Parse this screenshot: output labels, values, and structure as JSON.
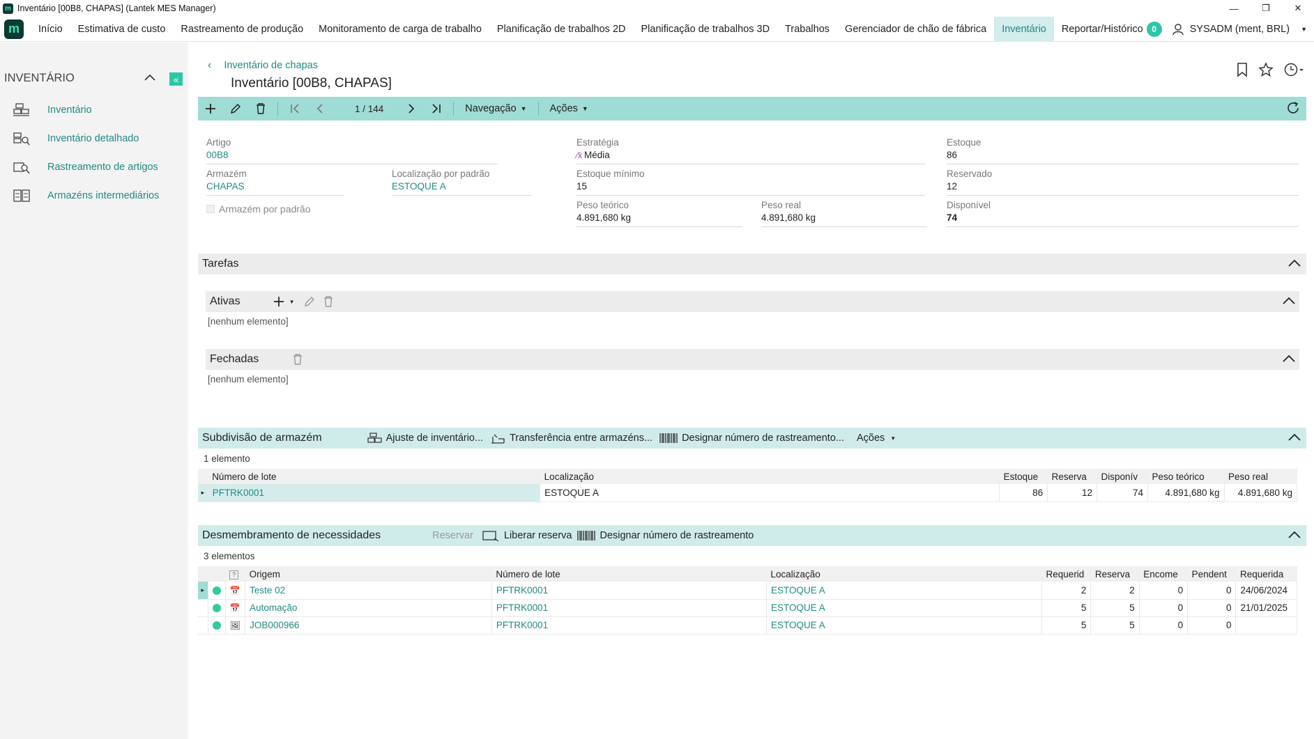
{
  "window": {
    "title": "Inventário [00B8, CHAPAS] (Lantek MES Manager)"
  },
  "menu": {
    "items": [
      "Início",
      "Estimativa de custo",
      "Rastreamento de produção",
      "Monitoramento de carga de trabalho",
      "Planificação de trabalhos 2D",
      "Planificação de trabalhos 3D",
      "Trabalhos",
      "Gerenciador de chão de fábrica",
      "Inventário",
      "Reportar/Histórico"
    ],
    "notifications": "0",
    "user": "SYSADM (ment, BRL)"
  },
  "sidebar": {
    "heading": "INVENTÁRIO",
    "items": [
      {
        "label": "Inventário",
        "icon": "inventory-icon"
      },
      {
        "label": "Inventário detalhado",
        "icon": "detailed-inventory-icon"
      },
      {
        "label": "Rastreamento de artigos",
        "icon": "item-tracking-icon"
      },
      {
        "label": "Armazéns intermediários",
        "icon": "intermediate-warehouse-icon"
      }
    ]
  },
  "header": {
    "breadcrumb": "Inventário de chapas",
    "title": "Inventário [00B8, CHAPAS]"
  },
  "toolbar": {
    "pager": "1 / 144",
    "navigation": "Navegação",
    "actions": "Ações"
  },
  "form": {
    "artigo": {
      "label": "Artigo",
      "value": "00B8"
    },
    "armazem": {
      "label": "Armazém",
      "value": "CHAPAS"
    },
    "localizacao": {
      "label": "Localização por padrão",
      "value": "ESTOQUE A"
    },
    "armazem_padrao": {
      "label": "Armazém por padrão"
    },
    "estrategia": {
      "label": "Estratégia",
      "value": "Média"
    },
    "estoque_minimo": {
      "label": "Estoque mínimo",
      "value": "15"
    },
    "peso_teorico": {
      "label": "Peso teórico",
      "value": "4.891,680 kg"
    },
    "peso_real": {
      "label": "Peso real",
      "value": "4.891,680 kg"
    },
    "estoque": {
      "label": "Estoque",
      "value": "86"
    },
    "reservado": {
      "label": "Reservado",
      "value": "12"
    },
    "disponivel": {
      "label": "Disponível",
      "value": "74"
    }
  },
  "tarefas": {
    "title": "Tarefas",
    "ativas": {
      "title": "Ativas",
      "empty": "[nenhum elemento]"
    },
    "fechadas": {
      "title": "Fechadas",
      "empty": "[nenhum elemento]"
    }
  },
  "subdivisao": {
    "title": "Subdivisão de armazém",
    "actions": [
      "Ajuste de inventário...",
      "Transferência entre armazéns...",
      "Designar número de rastreamento...",
      "Ações"
    ],
    "count": "1 elemento",
    "columns": [
      "Número de lote",
      "Localização",
      "Estoque",
      "Reserva",
      "Disponív",
      "Peso teórico",
      "Peso real"
    ],
    "rows": [
      {
        "lote": "PFTRK0001",
        "loc": "ESTOQUE A",
        "estoque": "86",
        "reserva": "12",
        "disp": "74",
        "peso_teo": "4.891,680 kg",
        "peso_real": "4.891,680 kg"
      }
    ]
  },
  "desmembramento": {
    "title": "Desmembramento de necessidades",
    "actions": [
      "Reservar",
      "Liberar reserva",
      "Designar número de rastreamento"
    ],
    "count": "3 elementos",
    "columns": [
      "?",
      "Origem",
      "Número de lote",
      "Localização",
      "Requerid",
      "Reserva",
      "Encome",
      "Pendent",
      "Requerida"
    ],
    "rows": [
      {
        "origem": "Teste 02",
        "lote": "PFTRK0001",
        "loc": "ESTOQUE A",
        "req": "2",
        "res": "2",
        "enc": "0",
        "pend": "0",
        "data": "24/06/2024"
      },
      {
        "origem": "Automação",
        "lote": "PFTRK0001",
        "loc": "ESTOQUE A",
        "req": "5",
        "res": "5",
        "enc": "0",
        "pend": "0",
        "data": "21/01/2025"
      },
      {
        "origem": "JOB000966",
        "lote": "PFTRK0001",
        "loc": "ESTOQUE A",
        "req": "5",
        "res": "5",
        "enc": "0",
        "pend": "0",
        "data": ""
      }
    ]
  },
  "colors": {
    "accent": "#1f8a85",
    "toolbar": "#9fdcd5",
    "status_dot": "#35c99f",
    "notif": "#2cc6a8"
  }
}
